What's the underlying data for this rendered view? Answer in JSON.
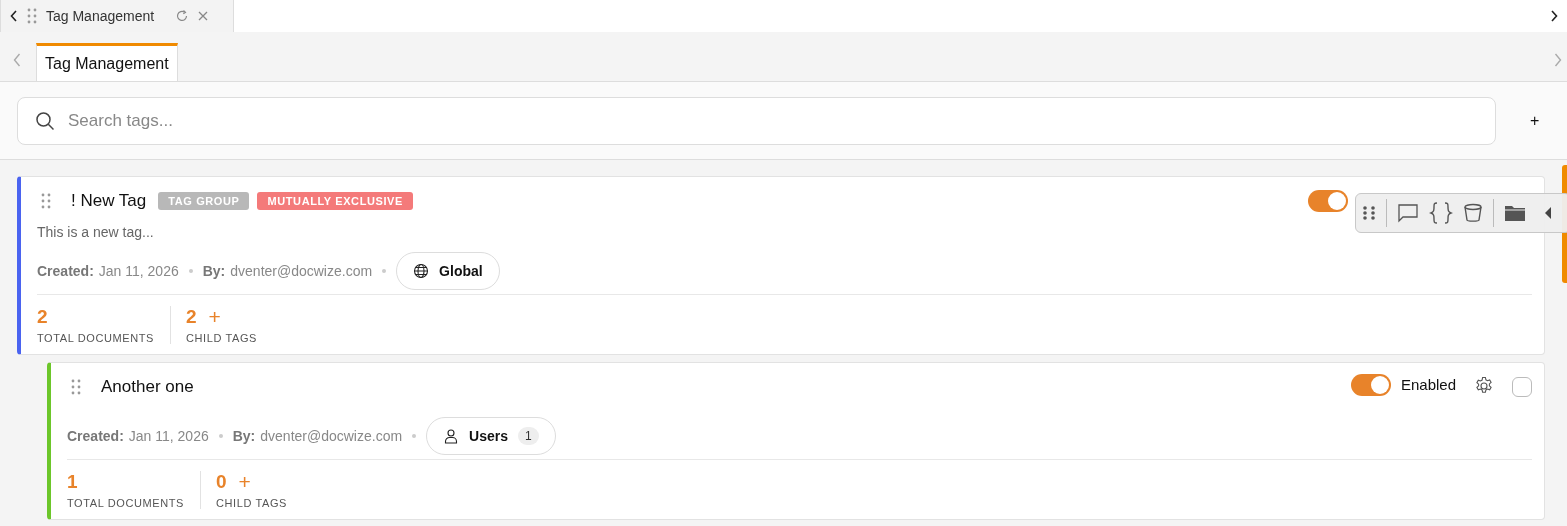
{
  "browser_tab": {
    "title": "Tag Management"
  },
  "tab_bar": {
    "tabs": [
      {
        "label": "Tag Management",
        "selected": true
      }
    ]
  },
  "search": {
    "placeholder": "Search tags...",
    "add_button": "+"
  },
  "tags": [
    {
      "name": "! New Tag",
      "color": "#4a63f0",
      "badges": [
        {
          "label": "TAG GROUP",
          "color": "#b8b8b8"
        },
        {
          "label": "MUTUALLY EXCLUSIVE",
          "color": "#f47a7a"
        }
      ],
      "description": "This is a new tag...",
      "enabled": true,
      "created_label": "Created:",
      "created": "Jan 11, 2026",
      "by_label": "By:",
      "by": "dventer@docwize.com",
      "scope": {
        "kind": "global",
        "label": "Global"
      },
      "total_documents": "2",
      "total_label": "TOTAL DOCUMENTS",
      "child_tags": "2",
      "child_label": "CHILD TAGS",
      "add_child": "+",
      "children": [
        {
          "name": "Another one",
          "color": "#6cc62a",
          "enabled": true,
          "enabled_label": "Enabled",
          "checked": false,
          "created_label": "Created:",
          "created": "Jan 11, 2026",
          "by_label": "By:",
          "by": "dventer@docwize.com",
          "scope": {
            "kind": "users",
            "label": "Users",
            "count": "1"
          },
          "total_documents": "1",
          "total_label": "TOTAL DOCUMENTS",
          "child_tags": "0",
          "child_label": "CHILD TAGS",
          "add_child": "+"
        }
      ]
    }
  ],
  "dev_toolbar": {
    "shown": true
  }
}
